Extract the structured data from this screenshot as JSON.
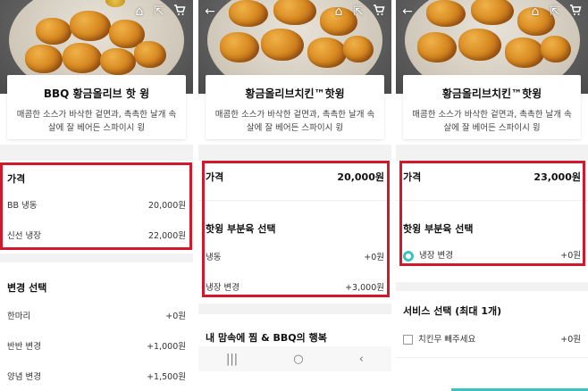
{
  "panels": [
    {
      "title": "BBQ 황금올리브 핫 윙",
      "desc_line1": "매콤한 소스가 바삭한 겉면과, 촉촉한 날개 속",
      "desc_line2": "살에 잘 베어든 스파이시 윙",
      "price_header": "가격",
      "price_rows": [
        {
          "label": "BB 냉동",
          "value": "20,000원"
        },
        {
          "label": "신선 냉장",
          "value": "22,000원"
        }
      ],
      "change_header": "변경 선택",
      "change_rows": [
        {
          "label": "한마리",
          "value": "+0원"
        },
        {
          "label": "반반 변경",
          "value": "+1,000원"
        },
        {
          "label": "양념 변경",
          "value": "+1,500원"
        }
      ]
    },
    {
      "title": "황금올리브치킨™핫윙",
      "desc_line1": "매콤한 소스가 바삭한 겉면과, 촉촉한 날개 속",
      "desc_line2": "살에 잘 베어든 스파이시 윙",
      "price_header": "가격",
      "price_value": "20,000원",
      "part_header": "핫윙 부분육 선택",
      "part_rows": [
        {
          "label": "냉동",
          "value": "+0원"
        },
        {
          "label": "냉장 변경",
          "value": "+3,000원"
        }
      ],
      "bottom_text": "내 맘속에 찜 & BBQ의 행복",
      "nav": {
        "recent": "|||",
        "home": "○",
        "back": "‹"
      }
    },
    {
      "title": "황금올리브치킨™핫윙",
      "desc_line1": "매콤한 소스가 바삭한 겉면과, 촉촉한 날개 속",
      "desc_line2": "살에 잘 베어든 스파이시 윙",
      "price_header": "가격",
      "price_value": "23,000원",
      "part_header": "핫윙 부분육 선택",
      "part_option": {
        "label": "냉장 변경",
        "value": "+0원"
      },
      "service_header": "서비스 선택 (최대 1개)",
      "service_option": {
        "label": "치킨무 빼주세요",
        "value": "+0원"
      }
    }
  ],
  "icons": {
    "back": "←",
    "home": "⌂",
    "share": "⇱",
    "cart": "🛒"
  },
  "colors": {
    "highlight": "#d0192b",
    "accent": "#3cc3c1"
  }
}
